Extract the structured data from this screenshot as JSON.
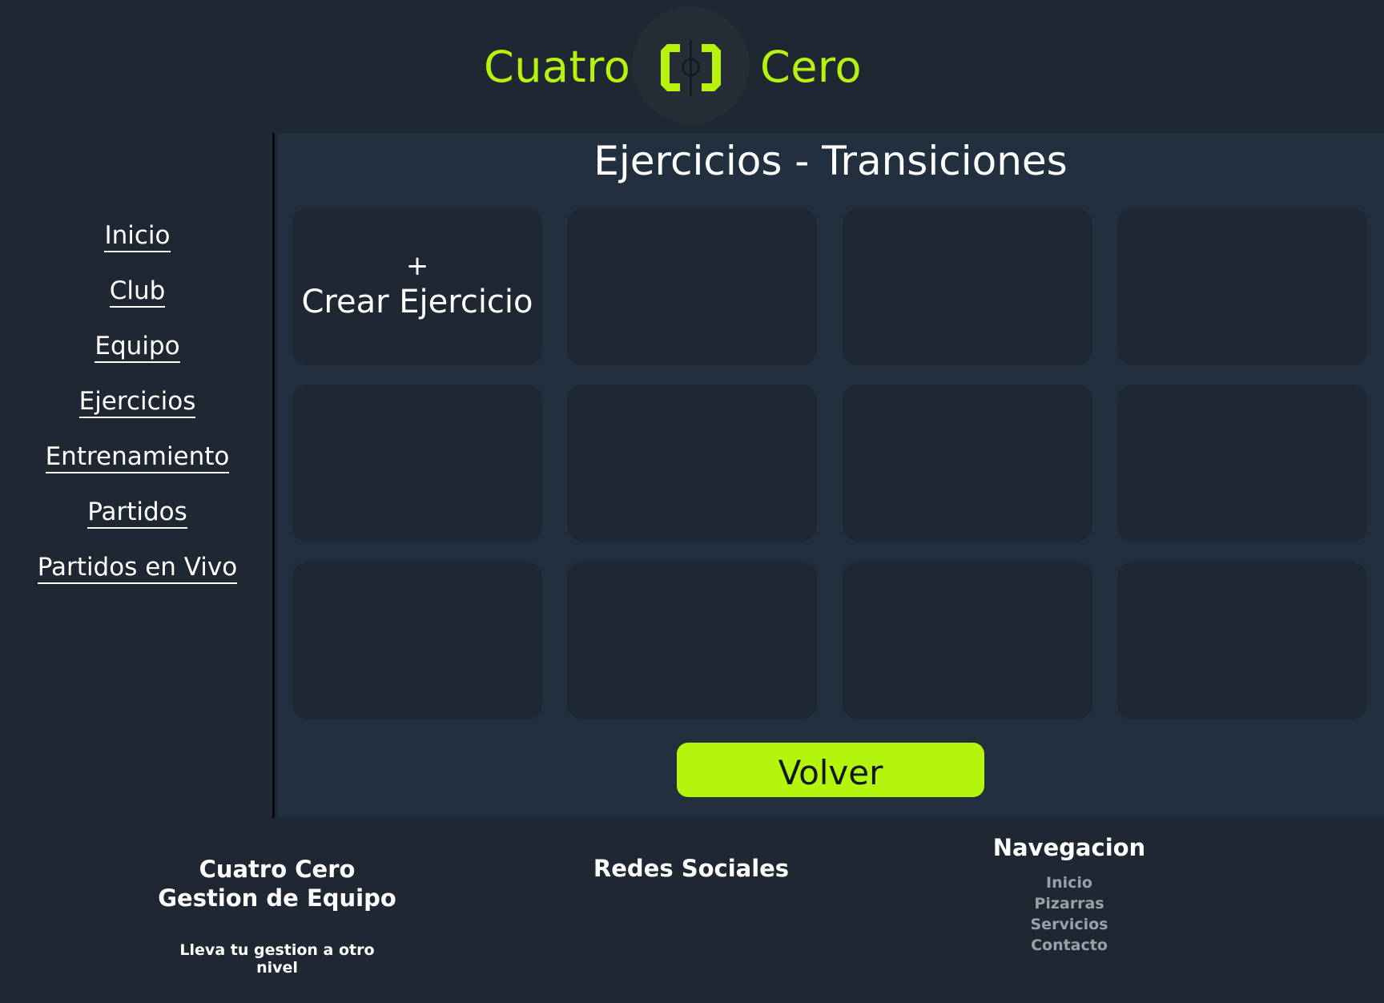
{
  "header": {
    "brand_left": "Cuatro",
    "brand_right": "Cero",
    "logo_icon": "cuatro-cero-logo-icon",
    "accent_color": "#b6f20c"
  },
  "sidebar": {
    "items": [
      {
        "label": "Inicio"
      },
      {
        "label": "Club"
      },
      {
        "label": "Equipo"
      },
      {
        "label": "Ejercicios"
      },
      {
        "label": "Entrenamiento"
      },
      {
        "label": "Partidos"
      },
      {
        "label": "Partidos en Vivo"
      }
    ]
  },
  "main": {
    "title": "Ejercicios - Transiciones",
    "create_card": {
      "plus": "+",
      "label": "Crear Ejercicio"
    },
    "volver_label": "Volver"
  },
  "footer": {
    "brand_line1": "Cuatro Cero",
    "brand_line2": "Gestion de Equipo",
    "tagline": "Lleva tu gestion a otro nivel",
    "social_title": "Redes Sociales",
    "nav_title": "Navegacion",
    "nav_links": [
      "Inicio",
      "Pizarras",
      "Servicios",
      "Contacto"
    ]
  }
}
